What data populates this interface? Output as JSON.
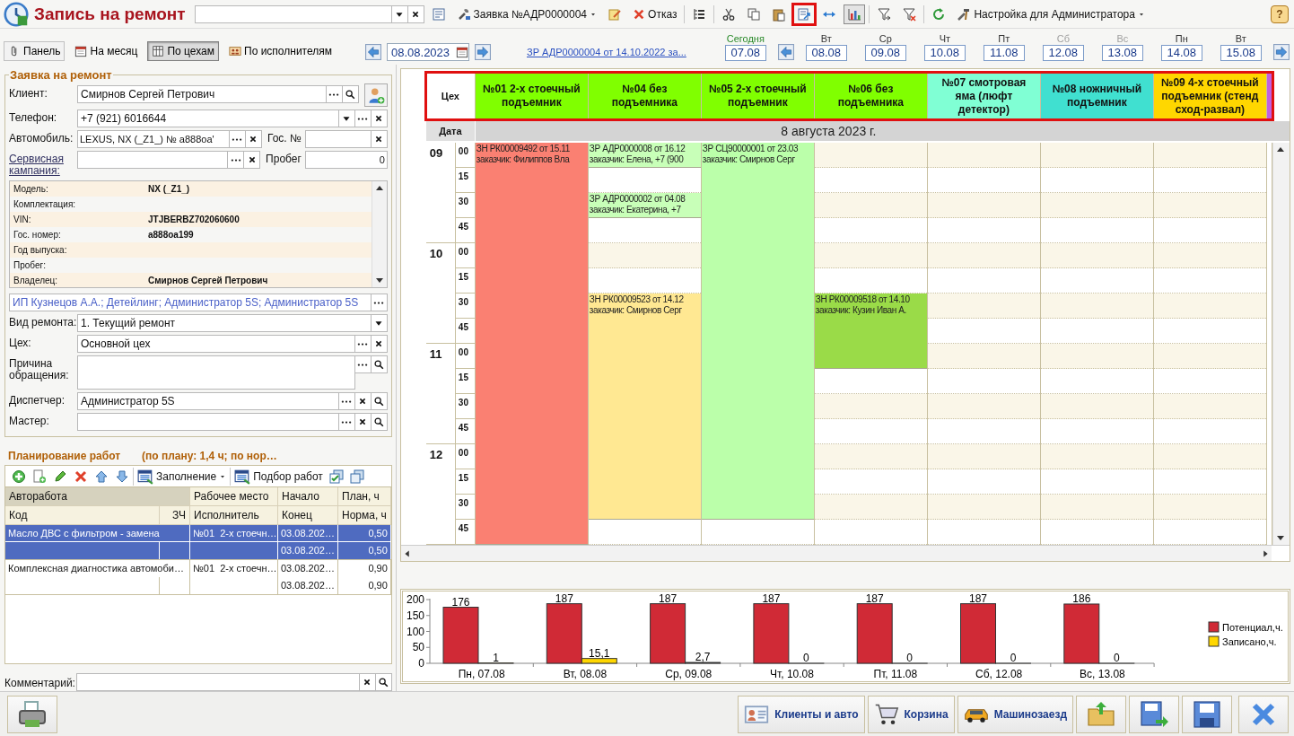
{
  "window": {
    "title": "Запись на ремонт",
    "help": "?"
  },
  "toolbar": [
    {
      "kind": "combo"
    },
    {
      "kind": "icon",
      "highlighted": false,
      "pressed": false
    },
    {
      "kind": "menu",
      "label": "Заявка №АДР0000004"
    },
    {
      "kind": "icon",
      "highlighted": false,
      "pressed": false
    },
    {
      "kind": "button",
      "label": "Отказ"
    },
    {
      "kind": "icon",
      "highlighted": false,
      "pressed": false
    },
    {
      "kind": "icon",
      "highlighted": false,
      "pressed": false
    },
    {
      "kind": "icon",
      "highlighted": false,
      "pressed": false
    },
    {
      "kind": "icon",
      "highlighted": false,
      "pressed": false
    },
    {
      "kind": "icon",
      "highlighted": true,
      "pressed": false
    },
    {
      "kind": "icon",
      "highlighted": false,
      "pressed": false
    },
    {
      "kind": "icon",
      "highlighted": false,
      "pressed": true
    },
    {
      "kind": "icon",
      "highlighted": false,
      "pressed": false
    },
    {
      "kind": "icon",
      "highlighted": false,
      "pressed": false
    },
    {
      "kind": "icon",
      "highlighted": false,
      "pressed": false
    },
    {
      "kind": "menu",
      "label": "Настройка для Администратора"
    }
  ],
  "view_buttons": [
    {
      "label": "Панель",
      "selected": false
    },
    {
      "label": "На месяц",
      "selected": false
    },
    {
      "label": "По цехам",
      "selected": true
    },
    {
      "label": "По исполнителям",
      "selected": false
    }
  ],
  "date": "08.08.2023",
  "order_link": "ЗР АДР0000004 от 14.10.2022 за...",
  "days": [
    {
      "weekday": "Сегодня",
      "date": "07.08",
      "kind": "today"
    },
    {
      "weekday": "Вт",
      "date": "08.08",
      "kind": "workday"
    },
    {
      "weekday": "Ср",
      "date": "09.08",
      "kind": "workday"
    },
    {
      "weekday": "Чт",
      "date": "10.08",
      "kind": "workday"
    },
    {
      "weekday": "Пт",
      "date": "11.08",
      "kind": "workday"
    },
    {
      "weekday": "Сб",
      "date": "12.08",
      "kind": "weekend"
    },
    {
      "weekday": "Вс",
      "date": "13.08",
      "kind": "weekend"
    },
    {
      "weekday": "Пн",
      "date": "14.08",
      "kind": "workday"
    },
    {
      "weekday": "Вт",
      "date": "15.08",
      "kind": "workday"
    }
  ],
  "form": {
    "title": "Заявка на ремонт",
    "rows": [
      {
        "fields": [
          {
            "label": "Клиент:",
            "value": "Смирнов Сергей Петрович",
            "kind": "lookup"
          }
        ],
        "add_button": true
      },
      {
        "fields": [
          {
            "label": "Телефон:",
            "value": "+7 (921) 6016644",
            "kind": "phone"
          }
        ]
      },
      {
        "fields": [
          {
            "label": "Автомобиль:",
            "value": "LEXUS, NX (_Z1_) № а888оа'",
            "kind": "reference"
          },
          {
            "label": "Гос. №",
            "kind": "clearable"
          }
        ]
      },
      {
        "fields": [
          {
            "label": "Сервисная кампания:",
            "link": true,
            "kind": "reference"
          },
          {
            "label": "Пробег",
            "value": "0",
            "kind": "number"
          }
        ]
      }
    ],
    "vehicle_info": [
      {
        "label": "Модель:",
        "value": "NX (_Z1_)"
      },
      {
        "label": "Комплектация:"
      },
      {
        "label": "VIN:",
        "value": "JTJBERBZ702060600"
      },
      {
        "label": "Гос. номер:",
        "value": "а888оа199"
      },
      {
        "label": "Год выпуска:"
      },
      {
        "label": "Пробег:"
      },
      {
        "label": "Владелец:",
        "value": "Смирнов Сергей Петрович"
      }
    ],
    "rows2": [
      {
        "fields": [
          {
            "value": "ИП Кузнецов А.А.; Детейлинг; Администратор 5S; Администратор 5S",
            "kind": "participants"
          }
        ]
      },
      {
        "fields": [
          {
            "label": "Вид ремонта:",
            "value": "1. Текущий ремонт",
            "kind": "select"
          }
        ]
      },
      {
        "fields": [
          {
            "label": "Цех:",
            "value": "Основной цех",
            "kind": "reference"
          }
        ]
      },
      {
        "fields": [
          {
            "label": "Причина обращения:",
            "kind": "memo"
          }
        ]
      },
      {
        "fields": [
          {
            "label": "Диспетчер:",
            "value": "Администратор 5S",
            "kind": "full"
          }
        ]
      },
      {
        "fields": [
          {
            "label": "Мастер:",
            "kind": "full"
          }
        ]
      }
    ]
  },
  "work_plan": {
    "title": "Планирование работ",
    "summary": "(по плану: 1,4 ч; по нор…",
    "toolbar": [
      {
        "kind": "icon"
      },
      {
        "kind": "icon"
      },
      {
        "kind": "icon"
      },
      {
        "kind": "icon"
      },
      {
        "kind": "icon"
      },
      {
        "kind": "icon"
      },
      {
        "kind": "menu",
        "label": "Заполнение"
      },
      {
        "kind": "button",
        "label": "Подбор работ"
      },
      {
        "kind": "icon"
      },
      {
        "kind": "icon"
      }
    ],
    "columns_top": [
      "Авторабота",
      "Рабочее место",
      "Начало",
      "План, ч"
    ],
    "columns_bottom": [
      "Код",
      "ЗЧ",
      "Исполнитель",
      "Конец",
      "Норма, ч"
    ],
    "rows": [
      {
        "name": "Масло ДВС с фильтром - замена",
        "place": "№01  2-х стоечн…",
        "start": "03.08.202…",
        "end": "03.08.202…",
        "plan": "0,50",
        "norm": "0,50",
        "selected": true
      },
      {
        "name": "Комплексная диагностика автомоби…",
        "place": "№01  2-х стоечн…",
        "start": "03.08.202…",
        "end": "03.08.202…",
        "plan": "0,90",
        "norm": "0,90",
        "selected": false
      }
    ]
  },
  "comment": {
    "label": "Комментарий:"
  },
  "schedule": {
    "corner": "Цех",
    "date_label": "Дата",
    "date": "8 августа 2023 г.",
    "columns": [
      {
        "name": "№01  2-х стоечный подъемник",
        "color": "#80ff00",
        "cells": [
          {
            "kind": "appointment",
            "title": "ЗН РК00009492 от 15.11",
            "customer": "заказчик: Филиппов Вла",
            "color": "#fa8072"
          },
          {
            "kind": "busy"
          },
          {
            "kind": "busy"
          },
          {
            "kind": "busy"
          },
          {
            "kind": "busy"
          },
          {
            "kind": "busy"
          },
          {
            "kind": "busy"
          },
          {
            "kind": "busy"
          },
          {
            "kind": "busy"
          },
          {
            "kind": "busy"
          },
          {
            "kind": "busy"
          },
          {
            "kind": "busy"
          },
          {
            "kind": "busy"
          },
          {
            "kind": "busy"
          },
          {
            "kind": "busy"
          },
          {
            "kind": "busy"
          }
        ]
      },
      {
        "name": "№04  без подъемника",
        "color": "#80ff00",
        "cells": [
          {
            "kind": "appointment",
            "title": "ЗР АДР0000008 от 16.12",
            "customer": "заказчик: Елена, +7 (900",
            "color": "#c8ffb8"
          },
          {
            "kind": "free"
          },
          {
            "kind": "appointment",
            "title": "ЗР АДР0000002 от 04.08",
            "customer": "заказчик: Екатерина, +7",
            "color": "#c8ffb8"
          },
          {
            "kind": "free"
          },
          {
            "kind": "free"
          },
          {
            "kind": "free"
          },
          {
            "kind": "appointment",
            "title": "ЗН РК00009523 от 14.12",
            "customer": "заказчик: Смирнов Серг",
            "color": "#ffe892"
          },
          {
            "kind": "busy"
          },
          {
            "kind": "busy"
          },
          {
            "kind": "busy"
          },
          {
            "kind": "busy"
          },
          {
            "kind": "busy"
          },
          {
            "kind": "busy"
          },
          {
            "kind": "busy"
          },
          {
            "kind": "busy"
          },
          {
            "kind": "free"
          }
        ]
      },
      {
        "name": "№05  2-х стоечный подъемник",
        "color": "#80ff00",
        "cells": [
          {
            "kind": "appointment",
            "title": "ЗР СЦ90000001 от 23.03",
            "customer": "заказчик: Смирнов Серг",
            "color": "#bbffaa"
          },
          {
            "kind": "busy"
          },
          {
            "kind": "busy"
          },
          {
            "kind": "busy"
          },
          {
            "kind": "busy"
          },
          {
            "kind": "busy"
          },
          {
            "kind": "busy"
          },
          {
            "kind": "busy"
          },
          {
            "kind": "busy"
          },
          {
            "kind": "busy"
          },
          {
            "kind": "busy"
          },
          {
            "kind": "busy"
          },
          {
            "kind": "busy"
          },
          {
            "kind": "busy"
          },
          {
            "kind": "busy"
          },
          {
            "kind": "free"
          }
        ]
      },
      {
        "name": "№06  без подъемника",
        "color": "#80ff00",
        "cells": [
          {
            "kind": "free"
          },
          {
            "kind": "free"
          },
          {
            "kind": "free"
          },
          {
            "kind": "free"
          },
          {
            "kind": "free"
          },
          {
            "kind": "free"
          },
          {
            "kind": "appointment",
            "title": "ЗН РК00009518 от 14.10",
            "customer": "заказчик: Кузин Иван А.",
            "color": "#9adb48"
          },
          {
            "kind": "busy"
          },
          {
            "kind": "busy"
          },
          {
            "kind": "free"
          },
          {
            "kind": "free"
          },
          {
            "kind": "free"
          },
          {
            "kind": "free"
          },
          {
            "kind": "free"
          },
          {
            "kind": "free"
          },
          {
            "kind": "free"
          }
        ]
      },
      {
        "name": "№07  смотровая яма (люфт детектор)",
        "color": "#80ffd4"
      },
      {
        "name": "№08  ножничный подъемник",
        "color": "#40e0d0"
      },
      {
        "name": "№09  4-х стоечный подъемник (стенд сход-развал)",
        "color": "#ffd700"
      },
      {
        "color": "#c060e0"
      }
    ],
    "hours": [
      {
        "hour": "09",
        "minutes": [
          "00",
          "15",
          "30",
          "45"
        ]
      },
      {
        "hour": "10",
        "minutes": [
          "00",
          "15",
          "30",
          "45"
        ]
      },
      {
        "hour": "11",
        "minutes": [
          "00",
          "15",
          "30",
          "45"
        ]
      },
      {
        "hour": "12",
        "minutes": [
          "00",
          "15",
          "30",
          "45"
        ]
      }
    ]
  },
  "chart_data": {
    "type": "bar",
    "categories": [
      "Пн, 07.08",
      "Вт, 08.08",
      "Ср, 09.08",
      "Чт, 10.08",
      "Пт, 11.08",
      "Сб, 12.08",
      "Вс, 13.08"
    ],
    "series": [
      {
        "name": "Потенциал,ч.",
        "color": "#d02a36",
        "values": [
          176,
          187,
          187,
          187,
          187,
          187,
          186
        ],
        "value_labels": [
          "176",
          "187",
          "187",
          "187",
          "187",
          "187",
          "186"
        ]
      },
      {
        "name": "Записано,ч.",
        "color": "#ffd700",
        "values": [
          1,
          15.1,
          2.7,
          0,
          0,
          0,
          0
        ],
        "value_labels": [
          "1",
          "15,1",
          "2,7",
          "0",
          "0",
          "0",
          "0"
        ]
      }
    ],
    "ylim": [
      0,
      200
    ],
    "yticks": [
      0,
      50,
      100,
      150,
      200
    ],
    "legend": "right"
  },
  "bottom_buttons": [
    {
      "kind": "print"
    },
    {
      "kind": "clients",
      "label": "Клиенты и авто"
    },
    {
      "kind": "cart",
      "label": "Корзина"
    },
    {
      "kind": "arrival",
      "label": "Машинозаезд"
    },
    {
      "kind": "open"
    },
    {
      "kind": "save-as"
    },
    {
      "kind": "save"
    },
    {
      "kind": "close"
    }
  ]
}
